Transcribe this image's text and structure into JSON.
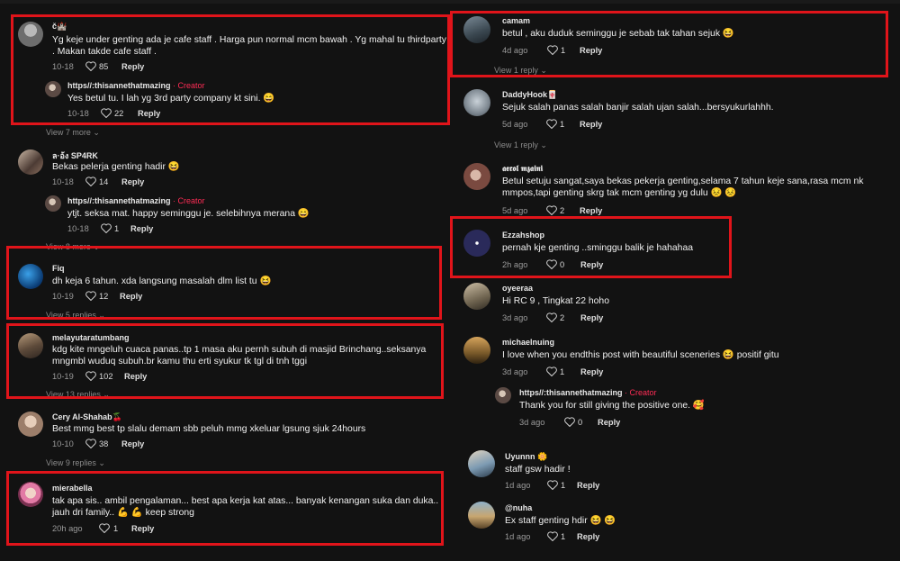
{
  "left": [
    {
      "id": "c1",
      "name": "č🏰",
      "text": [
        "Yg keje under genting ada je cafe staff . Harga pun normal mcm bawah . Yg mahal tu thirdparty",
        ". Makan takde cafe staff ."
      ],
      "date": "10-18",
      "likes": "85",
      "reply": "Reply"
    },
    {
      "id": "r1",
      "name": "https//:thisannethatmazing",
      "creator": "· Creator",
      "text": [
        "Yes betul tu. I lah yg 3rd party company kt sini. 😄"
      ],
      "date": "10-18",
      "likes": "22",
      "reply": "Reply"
    },
    {
      "id": "v1",
      "view": "View 7 more"
    },
    {
      "id": "c2",
      "name": "ล·อ้ง SP4RK",
      "text": [
        "Bekas pelerja genting hadir 😆"
      ],
      "date": "10-18",
      "likes": "14",
      "reply": "Reply"
    },
    {
      "id": "r2",
      "name": "https//:thisannethatmazing",
      "creator": "· Creator",
      "text": [
        "ytjt. seksa mat. happy seminggu je. selebihnya merana 😄"
      ],
      "date": "10-18",
      "likes": "1",
      "reply": "Reply"
    },
    {
      "id": "v2",
      "view": "View 8 more"
    },
    {
      "id": "c3",
      "name": "Fiq",
      "text": [
        "dh keja 6 tahun. xda langsung masalah dlm list tu 😆"
      ],
      "date": "10-19",
      "likes": "12",
      "reply": "Reply"
    },
    {
      "id": "v3",
      "view": "View 5 replies"
    },
    {
      "id": "c4",
      "name": "melayutaratumbang",
      "text": [
        "kdg kite mngeluh cuaca panas..tp 1 masa aku pernh subuh di masjid Brinchang..seksanya",
        "mngmbl wuduq subuh.br kamu thu erti syukur tk tgl di tnh tggi"
      ],
      "date": "10-19",
      "likes": "102",
      "reply": "Reply"
    },
    {
      "id": "v4",
      "view": "View 13 replies"
    },
    {
      "id": "c5",
      "name": "Cery Al-Shahab🍒",
      "text": [
        "Best mmg best tp slalu demam sbb peluh mmg xkeluar lgsung sjuk 24hours"
      ],
      "date": "10-10",
      "likes": "38",
      "reply": "Reply"
    },
    {
      "id": "v5",
      "view": "View 9 replies"
    },
    {
      "id": "c6",
      "name": "mierabella",
      "text": [
        "tak apa sis.. ambil pengalaman... best apa kerja kat atas... banyak kenangan suka dan duka..",
        "jauh dri family.. 💪 💪 keep strong"
      ],
      "date": "20h ago",
      "likes": "1",
      "reply": "Reply"
    }
  ],
  "right": [
    {
      "id": "d1",
      "name": "camam",
      "text": [
        "betul , aku duduk seminggu je sebab tak tahan sejuk 😆"
      ],
      "date": "4d ago",
      "likes": "1",
      "reply": "Reply"
    },
    {
      "id": "w1",
      "view": "View 1 reply"
    },
    {
      "id": "d2",
      "name": "DaddyHook🀄",
      "text": [
        "Sejuk salah panas salah banjir salah ujan salah...bersyukurlahhh."
      ],
      "date": "5d ago",
      "likes": "1",
      "reply": "Reply"
    },
    {
      "id": "w2",
      "view": "View 1 reply"
    },
    {
      "id": "d3",
      "name": "𝖆𝖊𝖗𝖔𝖑 𝖒𝖟𝖆𝖎𝖓𝖎",
      "text": [
        "Betul setuju sangat,saya bekas pekerja genting,selama 7 tahun keje sana,rasa mcm nk",
        "mmpos,tapi genting skrg tak mcm genting yg dulu 😣 😣"
      ],
      "date": "5d ago",
      "likes": "2",
      "reply": "Reply"
    },
    {
      "id": "d4",
      "name": "Ezzahshop",
      "text": [
        "pernah kje genting ..sminggu balik je hahahaa"
      ],
      "date": "2h ago",
      "likes": "0",
      "reply": "Reply"
    },
    {
      "id": "d5",
      "name": "oyeeraa",
      "text": [
        "Hi RC 9 , Tingkat 22 hoho"
      ],
      "date": "3d ago",
      "likes": "2",
      "reply": "Reply"
    },
    {
      "id": "d6",
      "name": "michaelnuing",
      "text": [
        "I love when you endthis post with beautiful sceneries 😆  positif gitu"
      ],
      "date": "3d ago",
      "likes": "1",
      "reply": "Reply"
    },
    {
      "id": "s1",
      "name": "https//:thisannethatmazing",
      "creator": "· Creator",
      "text": [
        "Thank you for still giving the positive one. 🥰"
      ],
      "date": "3d ago",
      "likes": "0",
      "reply": "Reply"
    },
    {
      "id": "d7",
      "name": "Uyunnn 🌼",
      "text": [
        "staff gsw hadir !"
      ],
      "date": "1d ago",
      "likes": "1",
      "reply": "Reply"
    },
    {
      "id": "d8",
      "name": "@nuha",
      "text": [
        "Ex staff genting hdir 😆 😆"
      ],
      "date": "1d ago",
      "likes": "1",
      "reply": "Reply"
    }
  ],
  "colors": {
    "accent": "#e0141a",
    "creator": "#fe2c55",
    "background": "#121212"
  },
  "icons": {
    "like": "heart-icon",
    "chevron": "chevron-down-icon"
  }
}
